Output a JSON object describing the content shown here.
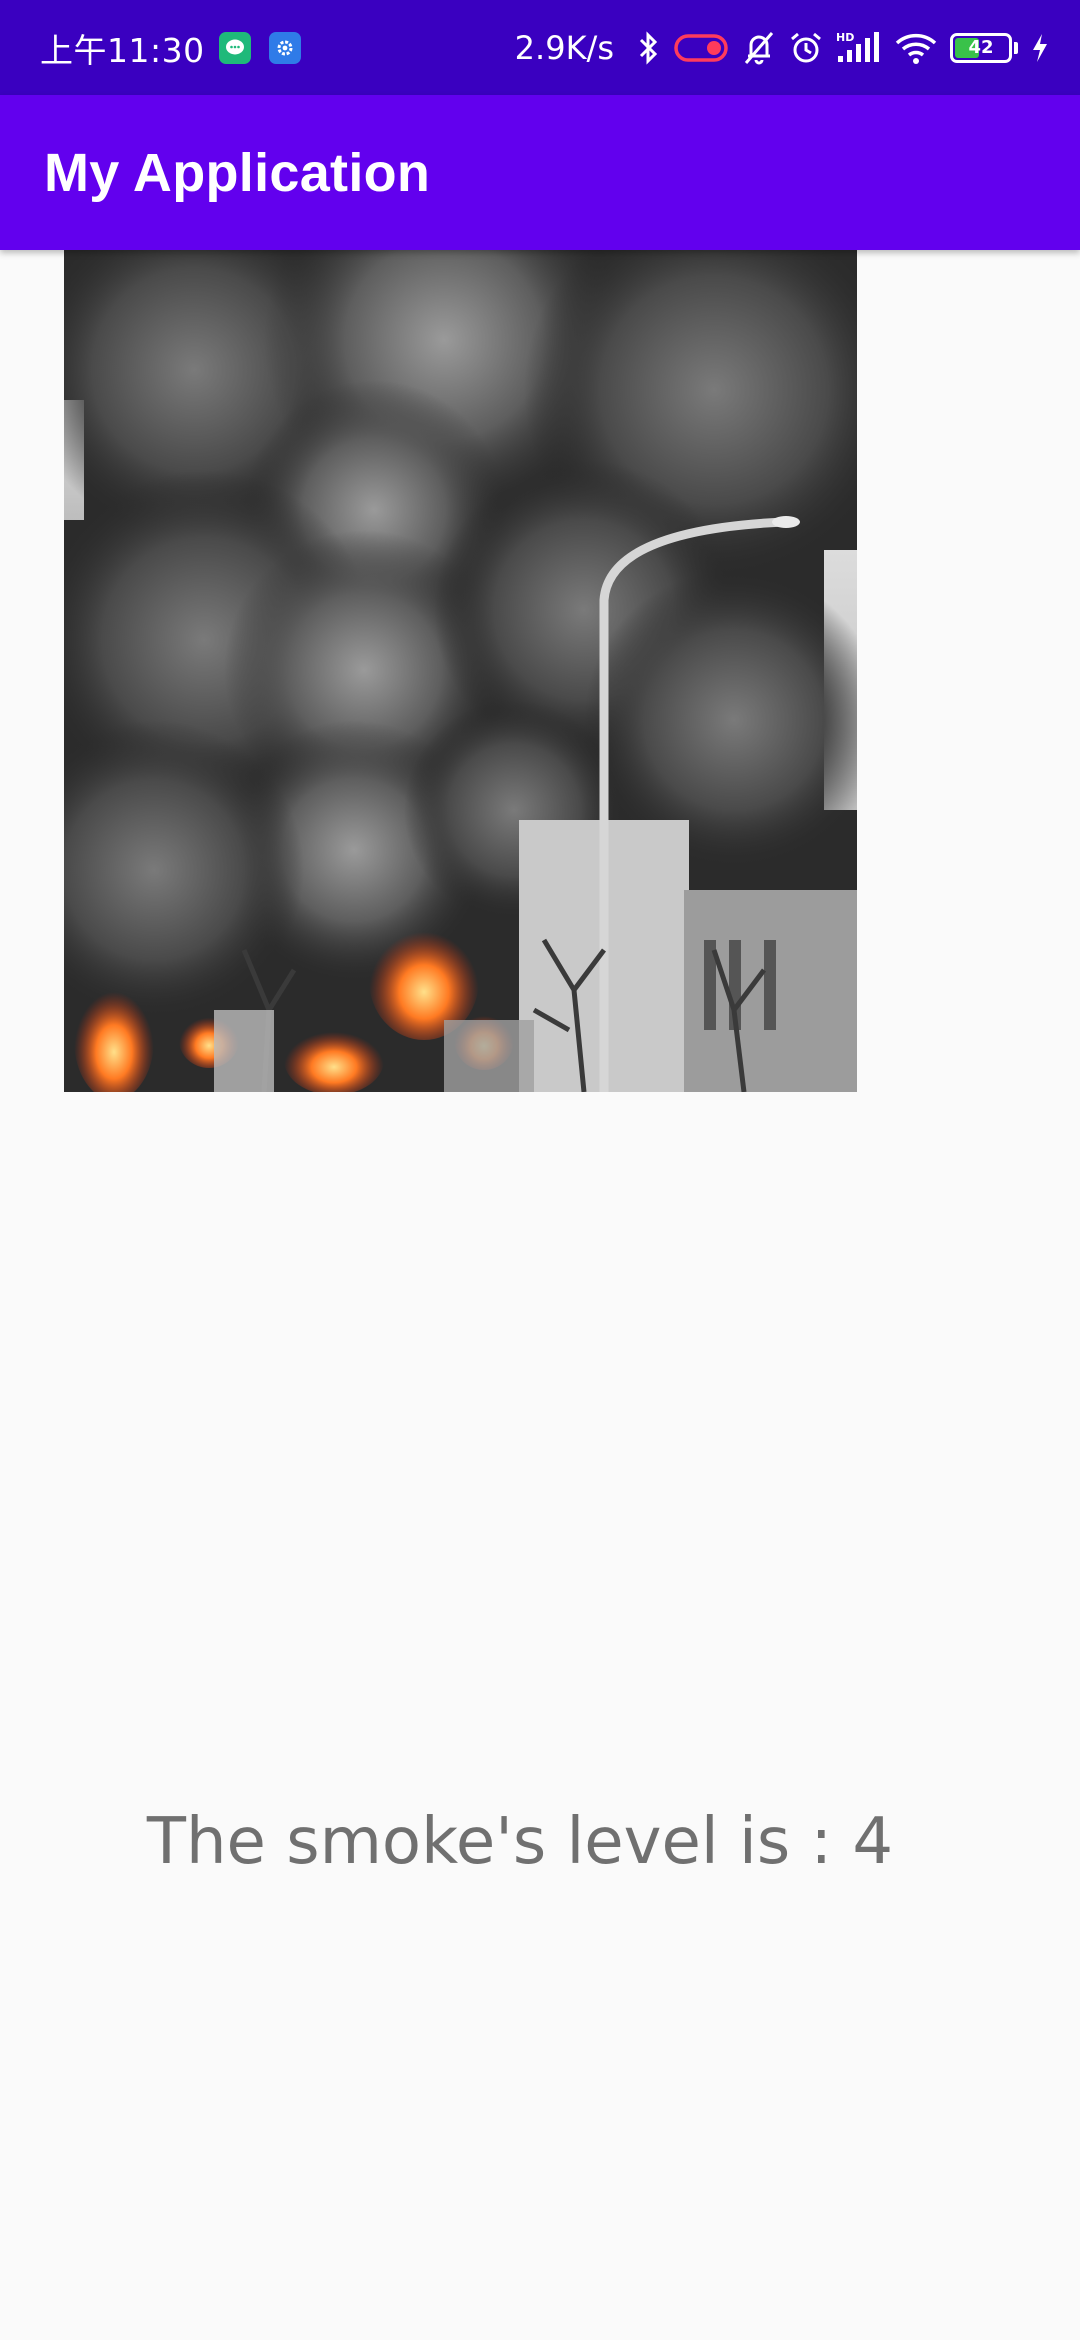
{
  "status_bar": {
    "time": "上午11:30",
    "net_speed": "2.9K/s",
    "battery_level": "42",
    "icons": [
      "chat-notification-icon",
      "settings-notification-icon",
      "bluetooth-icon",
      "toggle-icon",
      "mute-bell-icon",
      "alarm-icon",
      "hd-signal-icon",
      "wifi-icon",
      "battery-icon",
      "charging-icon"
    ]
  },
  "app_bar": {
    "title": "My Application",
    "color": "#6200ee"
  },
  "main": {
    "image_icon": "fire-smoke-photo",
    "smoke_text": "The smoke's level is : 4"
  },
  "colors": {
    "status_bar": "#3a00c0",
    "app_bar": "#6200ee",
    "background": "#fafafa",
    "text": "#707070"
  }
}
